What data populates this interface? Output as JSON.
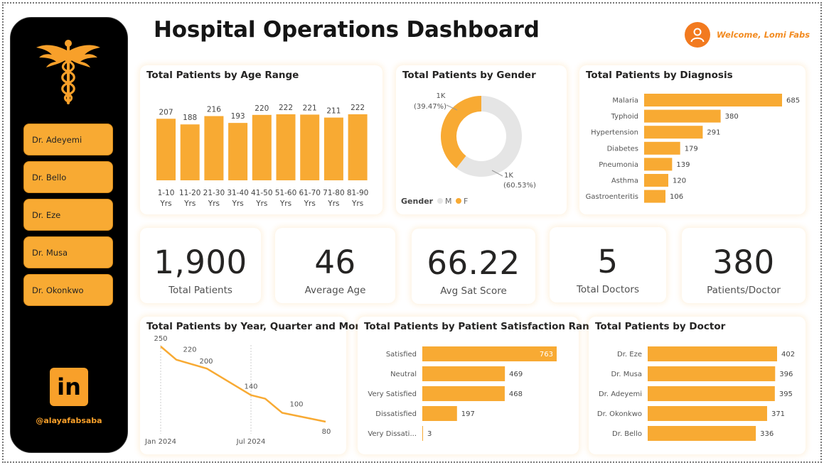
{
  "page_title": "Hospital Operations Dashboard",
  "welcome": "Welcome, Lomi Fabs",
  "sidebar": {
    "doctors": [
      "Dr. Adeyemi",
      "Dr. Bello",
      "Dr. Eze",
      "Dr. Musa",
      "Dr. Okonkwo"
    ],
    "linkedin_handle": "@alayafabsaba",
    "linkedin_logo": "in"
  },
  "colors": {
    "accent": "#F8AA33",
    "sidebar": "#000000",
    "donut_m": "#E5E5E5"
  },
  "kpis": [
    {
      "value": "1,900",
      "label": "Total Patients"
    },
    {
      "value": "46",
      "label": "Average Age"
    },
    {
      "value": "66.22",
      "label": "Avg Sat Score"
    },
    {
      "value": "5",
      "label": "Total Doctors"
    },
    {
      "value": "380",
      "label": "Patients/Doctor"
    }
  ],
  "chart_data": [
    {
      "id": "age",
      "type": "bar",
      "title": "Total Patients by Age Range",
      "categories": [
        [
          "1-10",
          "Yrs"
        ],
        [
          "11-20",
          "Yrs"
        ],
        [
          "21-30",
          "Yrs"
        ],
        [
          "31-40",
          "Yrs"
        ],
        [
          "41-50",
          "Yrs"
        ],
        [
          "51-60",
          "Yrs"
        ],
        [
          "61-70",
          "Yrs"
        ],
        [
          "71-80",
          "Yrs"
        ],
        [
          "81-90",
          "Yrs"
        ]
      ],
      "values": [
        207,
        188,
        216,
        193,
        220,
        222,
        221,
        211,
        222
      ]
    },
    {
      "id": "gender",
      "type": "pie",
      "title": "Total Patients by Gender",
      "legend_title": "Gender",
      "slices": [
        {
          "label": "M",
          "value": 60.53,
          "value_label": "1K",
          "pct_label": "(60.53%)"
        },
        {
          "label": "F",
          "value": 39.47,
          "value_label": "1K",
          "pct_label": "(39.47%)"
        }
      ]
    },
    {
      "id": "diagnosis",
      "type": "bar",
      "orientation": "horizontal",
      "title": "Total Patients by Diagnosis",
      "categories": [
        "Malaria",
        "Typhoid",
        "Hypertension",
        "Diabetes",
        "Pneumonia",
        "Asthma",
        "Gastroenteritis"
      ],
      "values": [
        685,
        380,
        291,
        179,
        139,
        120,
        106
      ]
    },
    {
      "id": "trend",
      "type": "line",
      "title": "Total Patients by Year, Quarter and Mon...",
      "x_ticks": [
        "Jan 2024",
        "Jul 2024"
      ],
      "values": [
        250,
        220,
        200,
        140,
        100,
        80
      ],
      "point_labels": [
        "250",
        "220",
        "200",
        "140",
        "100",
        "80"
      ]
    },
    {
      "id": "satisfaction",
      "type": "bar",
      "orientation": "horizontal",
      "title": "Total Patients by Patient Satisfaction Range",
      "categories": [
        "Satisfied",
        "Neutral",
        "Very Satisfied",
        "Dissatisfied",
        "Very Dissati..."
      ],
      "values": [
        763,
        469,
        468,
        197,
        3
      ]
    },
    {
      "id": "doctor",
      "type": "bar",
      "orientation": "horizontal",
      "title": "Total Patients by Doctor",
      "categories": [
        "Dr. Eze",
        "Dr. Musa",
        "Dr. Adeyemi",
        "Dr. Okonkwo",
        "Dr. Bello"
      ],
      "values": [
        402,
        396,
        395,
        371,
        336
      ]
    }
  ]
}
